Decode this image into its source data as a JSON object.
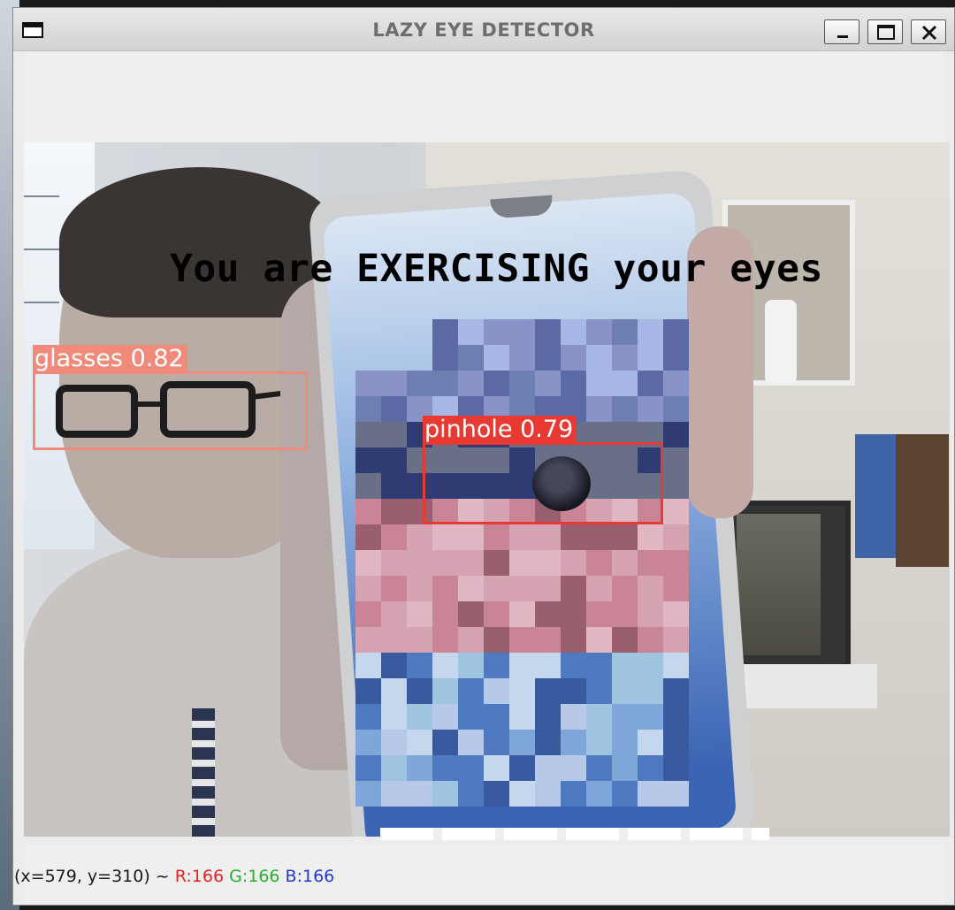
{
  "window": {
    "title": "LAZY EYE DETECTOR",
    "controls": {
      "minimize": "minimize-icon",
      "maximize": "maximize-icon",
      "close": "close-icon"
    }
  },
  "video": {
    "overlay_message": "You are EXERCISING your eyes",
    "detections": [
      {
        "label": "glasses 0.82",
        "class": "glasses",
        "confidence": 0.82,
        "color": "#f08b7c"
      },
      {
        "label": "pinhole 0.79",
        "class": "pinhole",
        "confidence": 0.79,
        "color": "#e83a32"
      }
    ]
  },
  "statusbar": {
    "coords": "(x=579, y=310) ~ ",
    "r": "R:166",
    "g": "G:166",
    "b": "B:166",
    "colors": {
      "r": "#e0261f",
      "g": "#27b02e",
      "b": "#2438c9"
    }
  }
}
